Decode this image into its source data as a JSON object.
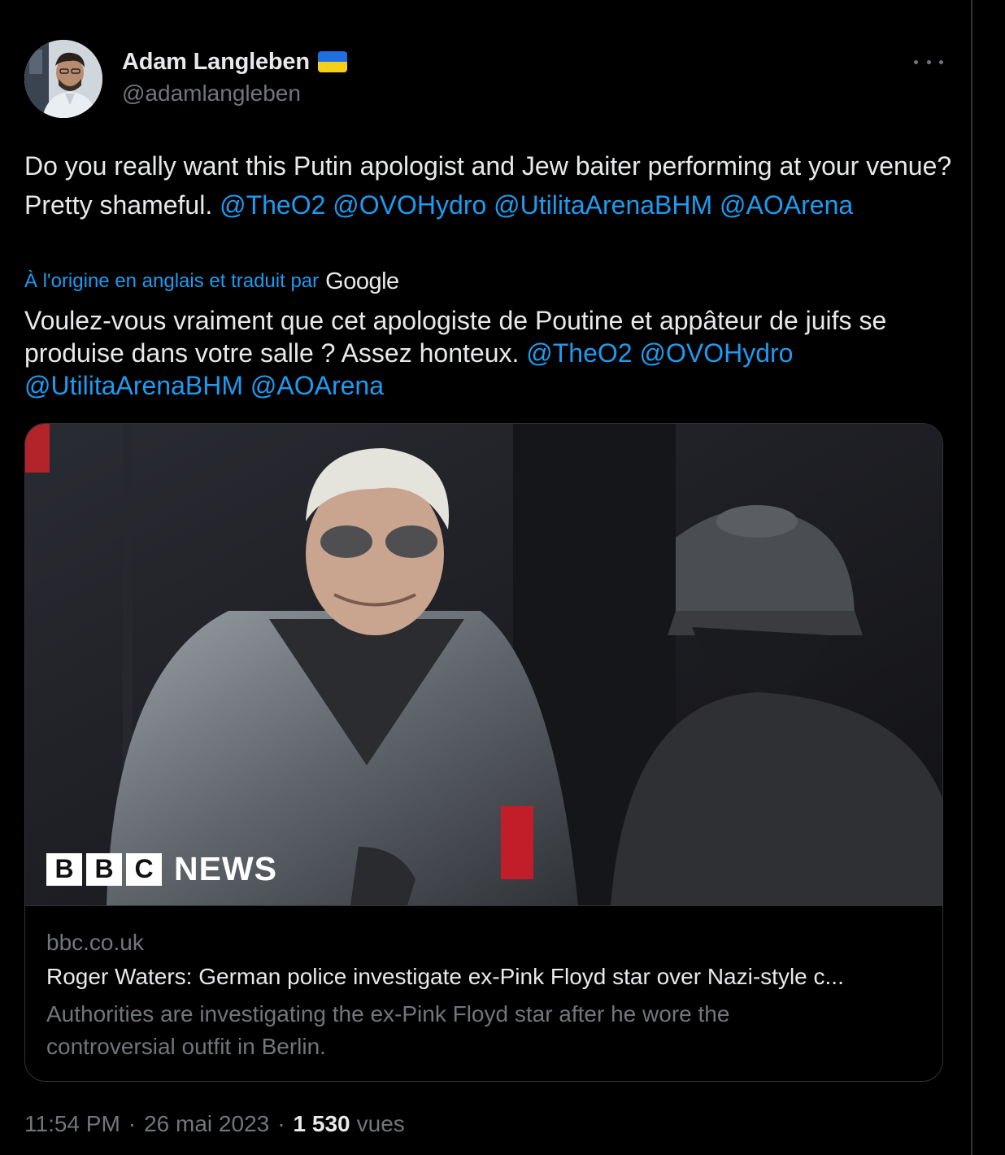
{
  "author": {
    "display_name": "Adam Langleben",
    "handle": "@adamlangleben",
    "flag": "ukraine-flag-icon"
  },
  "tweet": {
    "text_prefix": "Do you really want this Putin apologist and Jew baiter performing at your venue? Pretty shameful. ",
    "mentions": [
      "@TheO2",
      "@OVOHydro",
      "@UtilitaArenaBHM",
      "@AOArena"
    ]
  },
  "translation": {
    "label": "À l'origine en anglais et traduit par",
    "provider": "Google",
    "text_prefix": "Voulez-vous vraiment que cet apologiste de Poutine et appâteur de juifs se produise dans votre salle ? Assez honteux. ",
    "mentions": [
      "@TheO2",
      "@OVOHydro",
      "@UtilitaArenaBHM",
      "@AOArena"
    ]
  },
  "card": {
    "media_logo": {
      "letters": [
        "B",
        "B",
        "C"
      ],
      "word": "NEWS"
    },
    "domain": "bbc.co.uk",
    "title": "Roger Waters: German police investigate ex-Pink Floyd star over Nazi-style c...",
    "description": "Authorities are investigating the ex-Pink Floyd star after he wore the controversial outfit in Berlin."
  },
  "meta": {
    "time": "11:54 PM",
    "separator": "·",
    "date": "26 mai 2023",
    "views_count": "1 530",
    "views_label": "vues"
  },
  "colors": {
    "background": "#000000",
    "text": "#e7e9ea",
    "secondary": "#71767b",
    "link": "#1d9bf0",
    "border": "#2f3336"
  }
}
